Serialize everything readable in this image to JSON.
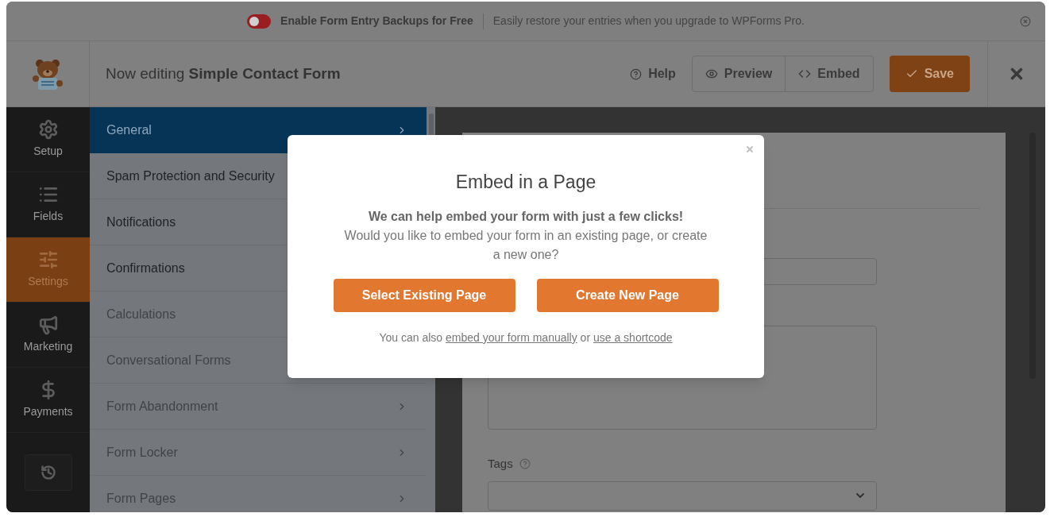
{
  "banner": {
    "toggle_on": false,
    "title": "Enable Form Entry Backups for Free",
    "message": "Easily restore your entries when you upgrade to WPForms Pro."
  },
  "header": {
    "prefix": "Now editing",
    "form_name": "Simple Contact Form",
    "help": "Help",
    "preview": "Preview",
    "embed": "Embed",
    "save": "Save"
  },
  "nav": [
    {
      "label": "Setup",
      "kind": "gear",
      "selected": false
    },
    {
      "label": "Fields",
      "kind": "fields",
      "selected": false
    },
    {
      "label": "Settings",
      "kind": "sliders",
      "selected": true
    },
    {
      "label": "Marketing",
      "kind": "megaphone",
      "selected": false
    },
    {
      "label": "Payments",
      "kind": "dollar",
      "selected": false
    }
  ],
  "settings_menu": [
    {
      "label": "General",
      "selected": true,
      "disabled": false
    },
    {
      "label": "Spam Protection and Security",
      "selected": false,
      "disabled": false
    },
    {
      "label": "Notifications",
      "selected": false,
      "disabled": false
    },
    {
      "label": "Confirmations",
      "selected": false,
      "disabled": false
    },
    {
      "label": "Calculations",
      "selected": false,
      "disabled": true
    },
    {
      "label": "Conversational Forms",
      "selected": false,
      "disabled": true
    },
    {
      "label": "Form Abandonment",
      "selected": false,
      "disabled": true
    },
    {
      "label": "Form Locker",
      "selected": false,
      "disabled": true
    },
    {
      "label": "Form Pages",
      "selected": false,
      "disabled": true
    }
  ],
  "form_preview": {
    "tags_label": "Tags"
  },
  "modal": {
    "title": "Embed in a Page",
    "lead": "We can help embed your form with just a few clicks!",
    "question": "Would you like to embed your form in an existing page, or create a new one?",
    "buttons": [
      "Select Existing Page",
      "Create New Page"
    ],
    "footer_prefix": "You can also",
    "link_manual": "embed your form manually",
    "footer_or": "or",
    "link_shortcode": "use a shortcode"
  }
}
